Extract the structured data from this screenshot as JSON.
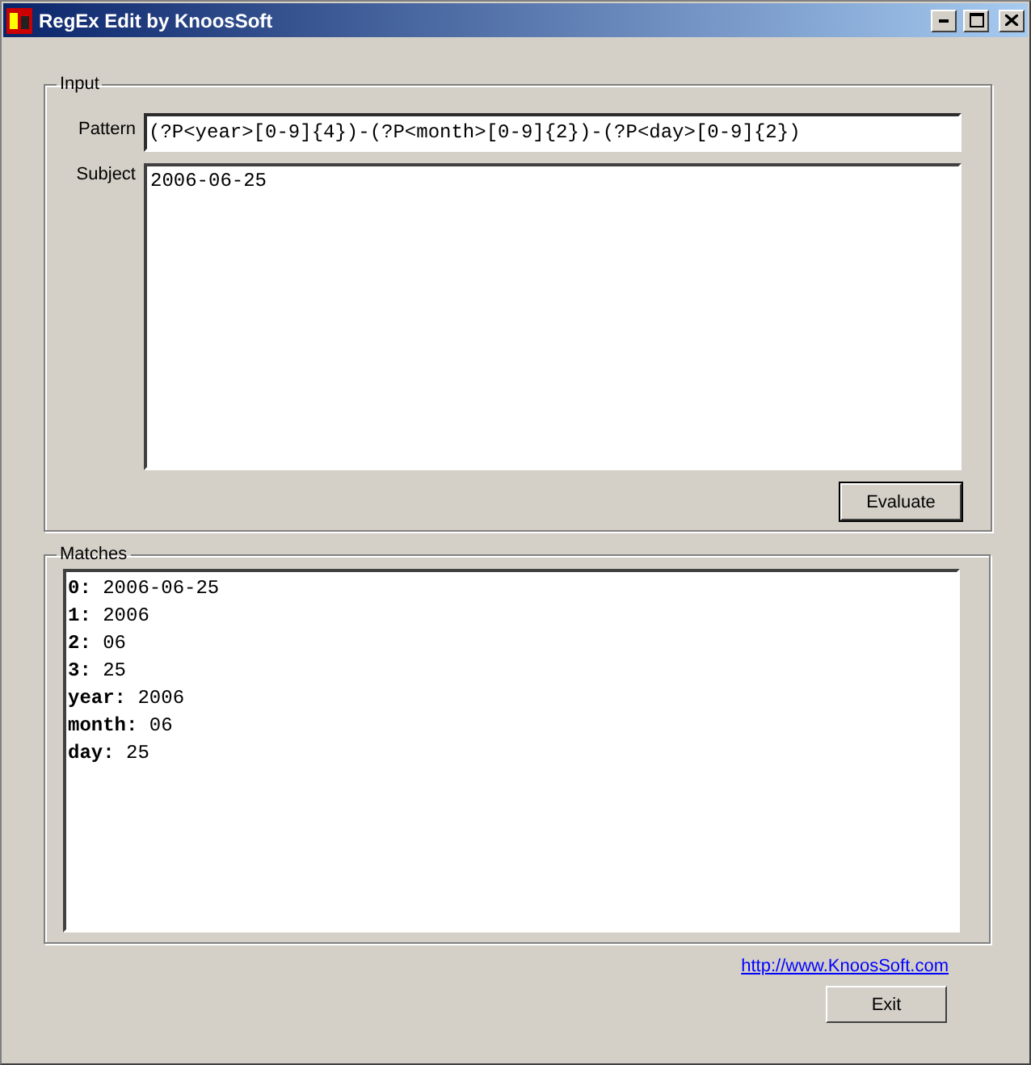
{
  "window": {
    "title": "RegEx Edit by KnoosSoft"
  },
  "input_group": {
    "legend": "Input",
    "pattern_label": "Pattern",
    "pattern": "(?P<year>[0-9]{4})-(?P<month>[0-9]{2})-(?P<day>[0-9]{2})",
    "subject_label": "Subject",
    "subject": "2006-06-25",
    "evaluate_button": "Evaluate"
  },
  "matches_group": {
    "legend": "Matches",
    "matches": [
      {
        "key": "0:",
        "value": "2006-06-25"
      },
      {
        "key": "1:",
        "value": "2006"
      },
      {
        "key": "2:",
        "value": "06"
      },
      {
        "key": "3:",
        "value": "25"
      },
      {
        "key": "year:",
        "value": "2006"
      },
      {
        "key": "month:",
        "value": "06"
      },
      {
        "key": "day:",
        "value": "25"
      }
    ]
  },
  "link": "http://www.KnoosSoft.com",
  "exit_button": "Exit"
}
